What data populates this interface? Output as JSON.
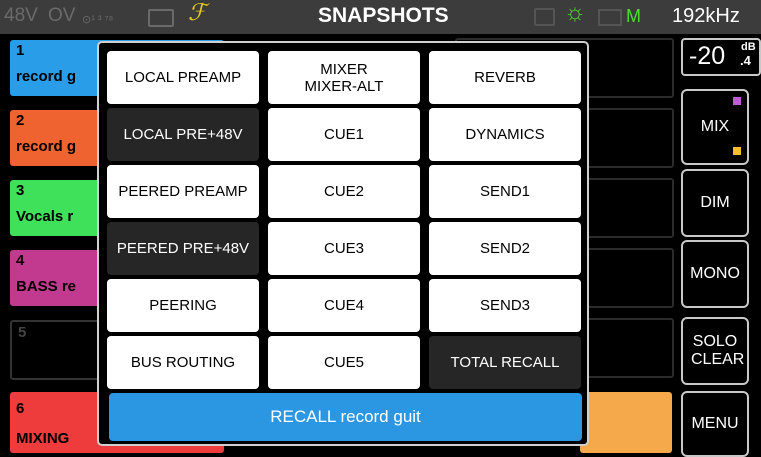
{
  "status": {
    "phantom": "48V",
    "overload": "OV",
    "routing_glyph": "⊙¹ ³ ⁷⁸",
    "fx_symbol": "ℱ",
    "title": "SNAPSHOTS",
    "sync_glyph": "☼",
    "m_label": "M",
    "sample_rate": "192kHz"
  },
  "channels": [
    {
      "num": "1",
      "name": "record g",
      "color": "#2a9de8"
    },
    {
      "num": "2",
      "name": "record g",
      "color": "#ee6330"
    },
    {
      "num": "3",
      "name": "Vocals r",
      "color": "#3fe05a"
    },
    {
      "num": "4",
      "name": "BASS re",
      "color": "#c23a8f"
    },
    {
      "num": "5",
      "name": "",
      "color": "#000000"
    },
    {
      "num": "6",
      "name": "MIXING",
      "color": "#ee3b3b"
    }
  ],
  "right_panel": {
    "level": "-20",
    "level_unit": "dB",
    "level_decimal": ".4",
    "buttons": [
      "MIX",
      "DIM",
      "MONO",
      "SOLO CLEAR",
      "MENU"
    ],
    "mix_indicator_colors": [
      "#c05ad8",
      "#f3c02a"
    ]
  },
  "popup": {
    "columns": [
      [
        "LOCAL PREAMP",
        "LOCAL PRE+48V",
        "PEERED PREAMP",
        "PEERED PRE+48V",
        "PEERING",
        "BUS ROUTING"
      ],
      [
        "MIXER\nMIXER-ALT",
        "CUE1",
        "CUE2",
        "CUE3",
        "CUE4",
        "CUE5"
      ],
      [
        "REVERB",
        "DYNAMICS",
        "SEND1",
        "SEND2",
        "SEND3",
        "TOTAL RECALL"
      ]
    ],
    "recall_label": "RECALL record guit"
  }
}
